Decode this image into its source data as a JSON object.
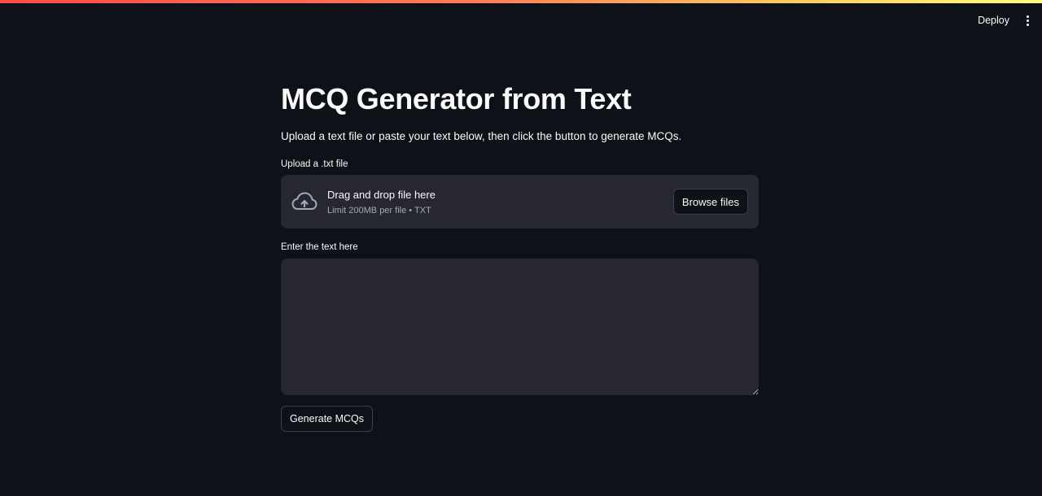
{
  "header": {
    "deploy_label": "Deploy",
    "menu_icon": "vertical-ellipsis-icon"
  },
  "main": {
    "title": "MCQ Generator from Text",
    "subtitle": "Upload a text file or paste your text below, then click the button to generate MCQs."
  },
  "file_uploader": {
    "label": "Upload a .txt file",
    "icon": "cloud-upload-icon",
    "dropzone_text": "Drag and drop file here",
    "limit_text": "Limit 200MB per file • TXT",
    "browse_label": "Browse files"
  },
  "text_input": {
    "label": "Enter the text here",
    "value": "",
    "placeholder": ""
  },
  "actions": {
    "generate_label": "Generate MCQs"
  },
  "colors": {
    "background": "#0e1117",
    "surface": "#262730",
    "text": "#fafafa",
    "muted_text": "#a3a8b8"
  }
}
